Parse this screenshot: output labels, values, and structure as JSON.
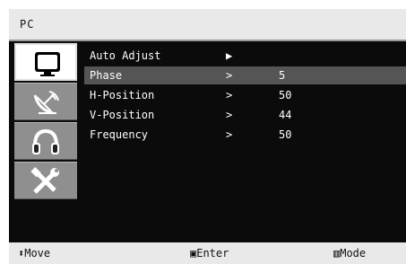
{
  "window": {
    "title": "PC"
  },
  "sidebar": {
    "items": [
      {
        "icon": "tv-monitor-icon",
        "active": true
      },
      {
        "icon": "satellite-dish-icon",
        "active": false
      },
      {
        "icon": "headphones-icon",
        "active": false
      },
      {
        "icon": "tools-icon",
        "active": false
      }
    ]
  },
  "menu": {
    "rows": [
      {
        "label": "Auto Adjust",
        "arrow": "▶",
        "value": ""
      },
      {
        "label": "Phase",
        "arrow": ">",
        "value": "5",
        "selected": true
      },
      {
        "label": "H-Position",
        "arrow": ">",
        "value": "50"
      },
      {
        "label": "V-Position",
        "arrow": ">",
        "value": "44"
      },
      {
        "label": "Frequency",
        "arrow": ">",
        "value": "50"
      }
    ]
  },
  "footer": {
    "move": "⬍Move",
    "enter": "▣Enter",
    "mode": "▥Mode"
  },
  "colors": {
    "background": "#0b0b0b",
    "bar": "#e9e9e9",
    "selected_row": "#555555",
    "sidebar_button": "#8f8f8f"
  }
}
